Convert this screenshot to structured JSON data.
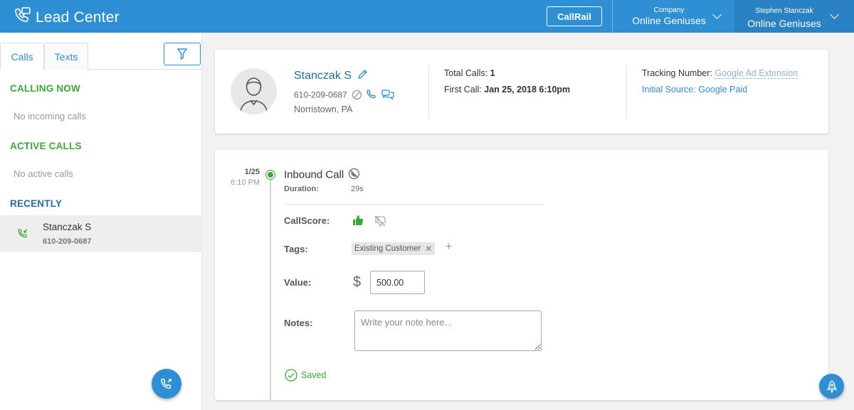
{
  "header": {
    "brand": "Lead Center",
    "callrail_label": "CallRail",
    "company_small": "Company",
    "company_name": "Online Geniuses",
    "user_small": "Stephen Stanczak",
    "user_company": "Online Geniuses",
    "color": "#2f8fd5"
  },
  "sidebar": {
    "tabs": [
      {
        "label": "Calls"
      },
      {
        "label": "Texts"
      }
    ],
    "calling_now": {
      "title": "CALLING NOW",
      "empty": "No incoming calls"
    },
    "active_calls": {
      "title": "ACTIVE CALLS",
      "empty": "No active calls"
    },
    "recently": {
      "title": "RECENTLY",
      "items": [
        {
          "name": "Stanczak S",
          "phone": "610-209-0687"
        }
      ]
    }
  },
  "contact": {
    "name": "Stanczak S",
    "phone": "610-209-0687",
    "location": "Norristown, PA",
    "total_calls_label": "Total Calls:",
    "total_calls": "1",
    "first_call_label": "First Call:",
    "first_call": "Jan 25, 2018 6:10pm",
    "tracking_label": "Tracking Number:",
    "tracking_value": "Google Ad Extension",
    "source_label": "Initial Source:",
    "source_value": "Google Paid"
  },
  "call": {
    "date": "1/25",
    "time": "6:10 PM",
    "title": "Inbound Call",
    "duration_label": "Duration:",
    "duration": "29s",
    "callscore_label": "CallScore:",
    "tags_label": "Tags:",
    "tags": [
      {
        "label": "Existing Customer"
      }
    ],
    "tag_add": "+",
    "value_label": "Value:",
    "currency": "$",
    "value": "500.00",
    "notes_label": "Notes:",
    "notes_placeholder": "Write your note here...",
    "saved_label": "Saved",
    "accent_green": "#3aaa35"
  }
}
